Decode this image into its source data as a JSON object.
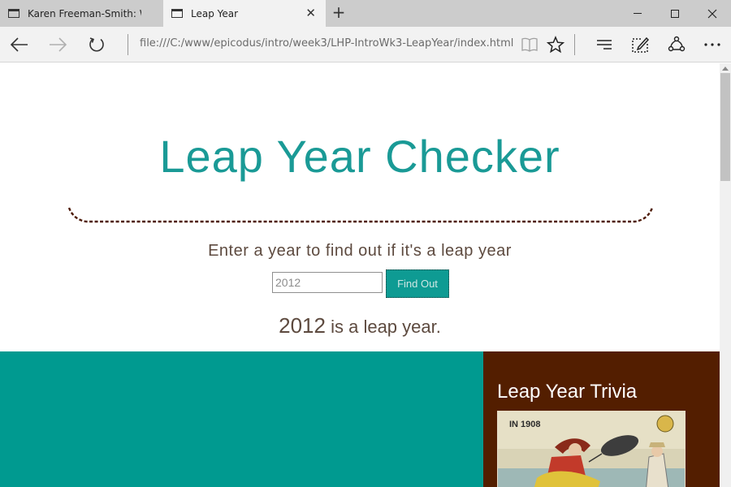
{
  "browser": {
    "tabs": [
      {
        "title": "Karen Freeman-Smith: Web"
      },
      {
        "title": "Leap Year"
      }
    ],
    "address": "file:///C:/www/epicodus/intro/week3/LHP-IntroWk3-LeapYear/index.html"
  },
  "page": {
    "title": "Leap Year Checker",
    "prompt": "Enter a year to find out if it's a leap year",
    "input": {
      "value": "2012"
    },
    "button_label": "Find Out",
    "result": {
      "year": "2012",
      "text": " is a leap year."
    },
    "trivia": {
      "title": "Leap Year Trivia",
      "image_caption": "IN 1908"
    }
  },
  "colors": {
    "teal": "#009a90",
    "brown": "#531e00",
    "title": "#1a9a96",
    "text": "#5d4a3f"
  }
}
